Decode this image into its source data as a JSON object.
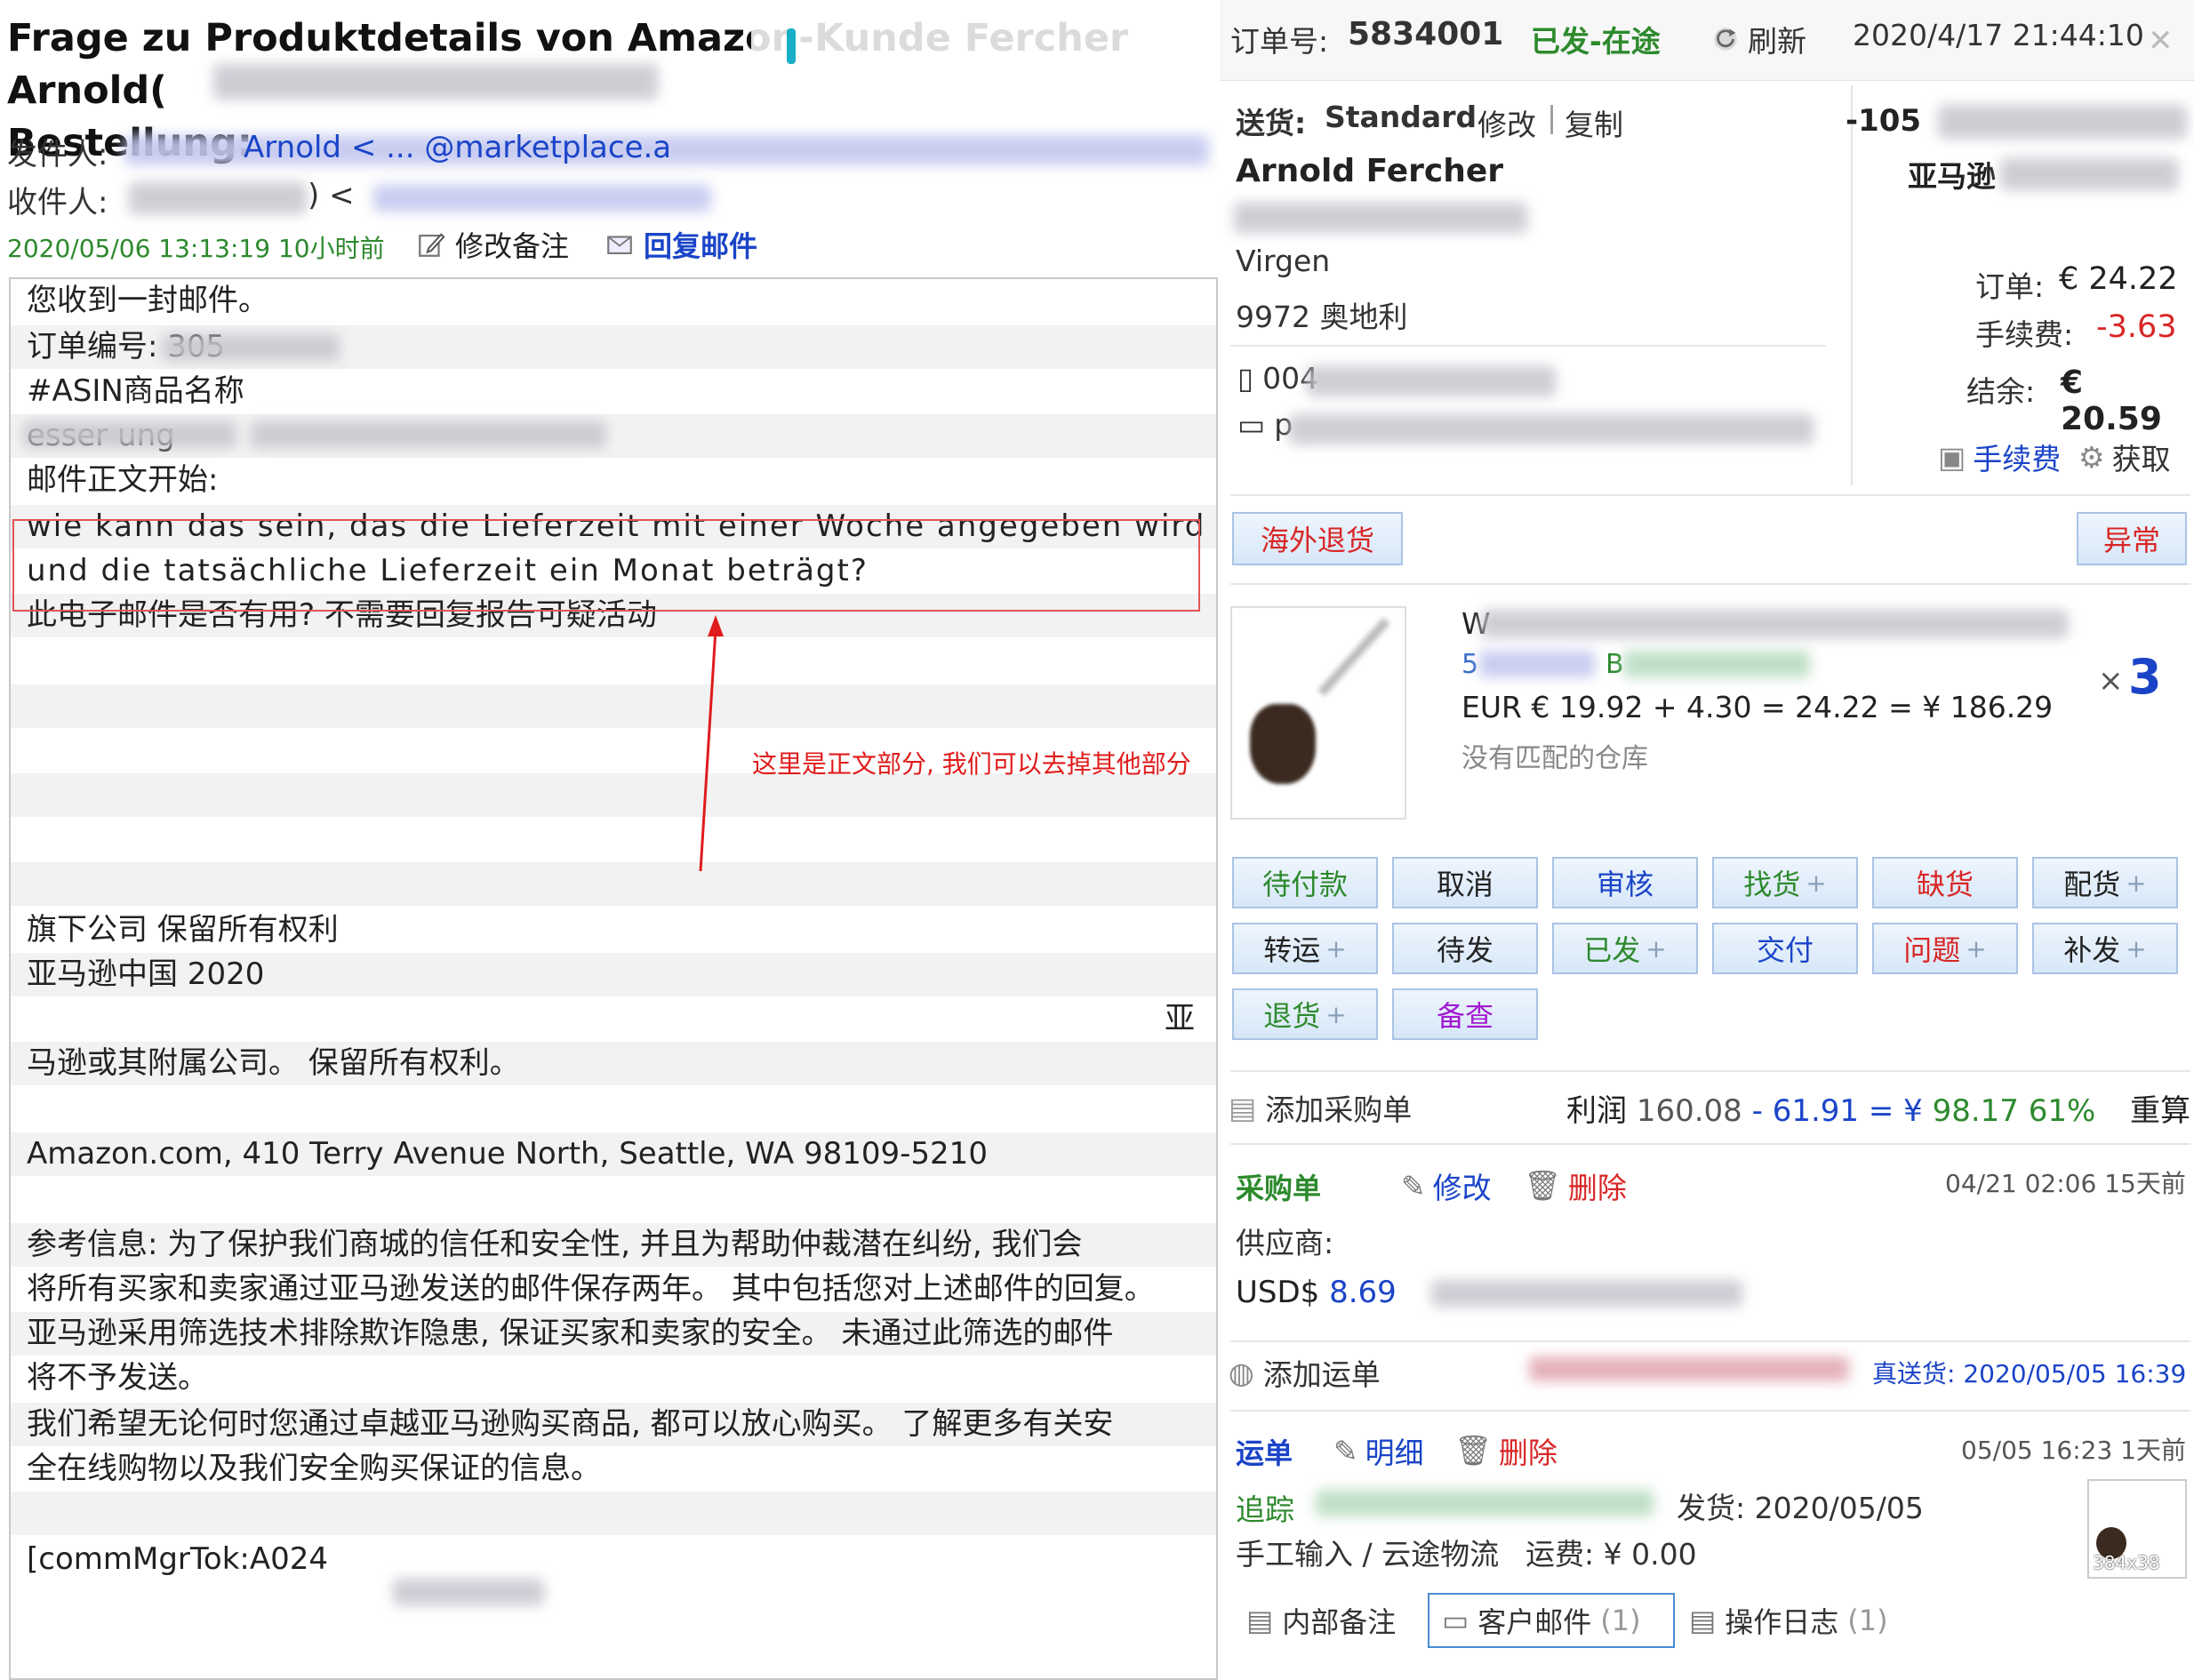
{
  "email": {
    "subject_line1": "Frage zu Produktdetails von Amazon-Kunde Fercher Arnold(",
    "subject_line2": "Bestellung:",
    "from_label": "发件人:",
    "from_value": "Arnold < ... @marketplace.a",
    "to_label": "收件人:",
    "to_value": ") <",
    "timestamp": "2020/05/06 13:13:19 10小时前",
    "edit_note": "修改备注",
    "reply": "回复邮件",
    "body_lines": [
      "您收到一封邮件。",
      "订单编号: 305",
      "#ASIN商品名称",
      "esser ung",
      "邮件正文开始:",
      "wie kann das sein, das die Lieferzeit mit einer Woche angegeben wird",
      "und  die tatsächliche Lieferzeit ein Monat beträgt?",
      "此电子邮件是否有用? 不需要回复报告可疑活动",
      "",
      "",
      "",
      "",
      "",
      "",
      "旗下公司 保留所有权利",
      "亚马逊中国 2020",
      "亚",
      "马逊或其附属公司。 保留所有权利。",
      "",
      "Amazon.com, 410 Terry Avenue North, Seattle, WA 98109-5210",
      "",
      "参考信息: 为了保护我们商城的信任和安全性, 并且为帮助仲裁潜在纠纷, 我们会",
      "将所有买家和卖家通过亚马逊发送的邮件保存两年。 其中包括您对上述邮件的回复。",
      "  亚马逊采用筛选技术排除欺诈隐患, 保证买家和卖家的安全。 未通过此筛选的邮件",
      "将不予发送。",
      "我们希望无论何时您通过卓越亚马逊购买商品, 都可以放心购买。 了解更多有关安",
      "全在线购物以及我们安全购买保证的信息。",
      "",
      "[commMgrTok:A024"
    ],
    "annotation": "这里是正文部分, 我们可以去掉其他部分"
  },
  "order": {
    "order_label": "订单号:",
    "order_no": "5834001",
    "status": "已发-在途",
    "refresh": "刷新",
    "datetime": "2020/4/17 21:44:10",
    "ship_label": "送货:",
    "ship_method": "Standard",
    "modify": "修改",
    "copy": "复制",
    "customer_name": "Arnold Fercher",
    "city": "Virgen",
    "postal_country": "9972  奥地利",
    "phone": "004",
    "email_prefix": "p",
    "ref_no": "-105",
    "platform": "亚马逊",
    "order_amount_label": "订单:",
    "order_amount": "€ 24.22",
    "fee_label": "手续费:",
    "fee": "-3.63",
    "balance_label": "结余:",
    "balance": "€ 20.59",
    "fee_link": "手续费",
    "fetch": "获取",
    "overseas_return": "海外退货",
    "exception": "异常"
  },
  "product": {
    "title_prefix": "W",
    "sku_prefix": "5",
    "sku_mid": "B",
    "price_line": "EUR € 19.92 + 4.30 = 24.22 = ¥ 186.29",
    "warehouse": "没有匹配的仓库",
    "qty_x": "×",
    "qty": "3"
  },
  "action_buttons": [
    {
      "label": "待付款",
      "color": "#2d8a2d",
      "plus": false
    },
    {
      "label": "取消",
      "color": "#222222",
      "plus": false
    },
    {
      "label": "审核",
      "color": "#1a44c8",
      "plus": false
    },
    {
      "label": "找货",
      "color": "#2d8a2d",
      "plus": true
    },
    {
      "label": "缺货",
      "color": "#d92626",
      "plus": false
    },
    {
      "label": "配货",
      "color": "#222222",
      "plus": true
    },
    {
      "label": "转运",
      "color": "#222222",
      "plus": true
    },
    {
      "label": "待发",
      "color": "#222222",
      "plus": false
    },
    {
      "label": "已发",
      "color": "#2d8a2d",
      "plus": true
    },
    {
      "label": "交付",
      "color": "#1a44c8",
      "plus": false
    },
    {
      "label": "问题",
      "color": "#d92626",
      "plus": true
    },
    {
      "label": "补发",
      "color": "#222222",
      "plus": true
    },
    {
      "label": "退货",
      "color": "#2d8a2d",
      "plus": true
    },
    {
      "label": "备查",
      "color": "#a21ad0",
      "plus": false
    }
  ],
  "profit": {
    "add_po": "添加采购单",
    "label": "利润",
    "v1": "160.08",
    "minus": "-",
    "v2": "61.91",
    "eq": "= ¥",
    "v3": "98.17",
    "pct": "61%",
    "recalc": "重算"
  },
  "purchase": {
    "title": "采购单",
    "modify": "修改",
    "delete": "删除",
    "time": "04/21 02:06 15天前",
    "supplier_label": "供应商:",
    "usd_label": "USD$",
    "usd_value": "8.69"
  },
  "shipping": {
    "add": "添加运单",
    "real_ship": "真送货: 2020/05/05 16:39",
    "title": "运单",
    "detail": "明细",
    "delete": "删除",
    "time": "05/05 16:23 1天前",
    "track": "追踪",
    "ship_label": "发货:",
    "ship_date": "2020/05/05",
    "manual": "手工输入 / 云途物流",
    "freight": "运费: ¥ 0.00",
    "thumb_caption": "384x38"
  },
  "tabs": [
    {
      "label": "内部备注",
      "count": ""
    },
    {
      "label": "客户邮件",
      "count": "(1)"
    },
    {
      "label": "操作日志",
      "count": "(1)"
    }
  ],
  "colors": {
    "accent_blue": "#1a44c8",
    "success": "#2d8a2d",
    "danger": "#d92626",
    "annotation": "#e01b1b"
  }
}
